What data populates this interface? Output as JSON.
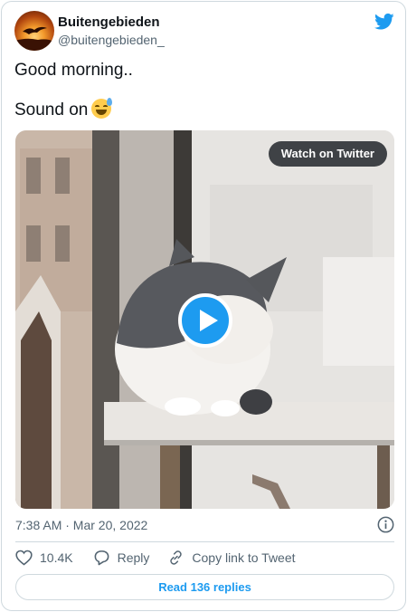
{
  "author": {
    "display_name": "Buitengebieden",
    "handle": "@buitengebieden_",
    "avatar_icon": "sunset-bird-avatar",
    "logo_icon": "twitter-bird-icon"
  },
  "tweet": {
    "line1": "Good morning..",
    "line2": "Sound on",
    "emoji_icon": "grinning-face-with-sweat-emoji"
  },
  "media": {
    "watch_label": "Watch on Twitter",
    "play_icon": "play-icon"
  },
  "meta": {
    "timestamp": "7:38 AM · Mar 20, 2022",
    "info_icon": "info-icon"
  },
  "actions": {
    "like_count": "10.4K",
    "reply_label": "Reply",
    "copy_label": "Copy link to Tweet"
  },
  "footer": {
    "read_replies_label": "Read 136 replies"
  },
  "colors": {
    "accent": "#1d9bf0",
    "text_primary": "#0f1419",
    "text_secondary": "#536471",
    "border": "#cfd9de"
  }
}
